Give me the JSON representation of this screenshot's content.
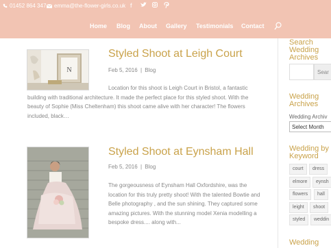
{
  "topbar": {
    "phone": "01452 864 347",
    "email": "emma@the-flower-girls.co.uk",
    "social_icons": [
      "facebook-icon",
      "twitter-icon",
      "instagram-icon",
      "pinterest-icon"
    ]
  },
  "nav": {
    "items": [
      "Home",
      "Blog",
      "About",
      "Gallery",
      "Testimonials",
      "Contact"
    ]
  },
  "posts": [
    {
      "title": "Styled Shoot at Leigh Court",
      "date": "Feb 5, 2016",
      "separator": "|",
      "category": "Blog",
      "excerpt": "Location for this shoot is Leigh Court in Bristol, a fantastic building with traditional architecture. It made the perfect place for this styled shoot. With the beauty of Sophie (Miss Cheltenham) this shoot came alive with her character! The flowers included, black…"
    },
    {
      "title": "Styled Shoot at Eynsham Hall",
      "date": "Feb 5, 2016",
      "separator": "|",
      "category": "Blog",
      "excerpt": "The gorgeousness of Eynsham Hall Oxfordshire, was the location for this truly pretty shoot! With the talented Bowtie and Belle photography , and the sun shining. They captured some amazing pictures. With the stunning model Xenia modelling a bespoke dress.... along with..."
    }
  ],
  "sidebar": {
    "search_title": "Search Wedding Archives",
    "search_button": "Sear",
    "archives_title": "Wedding Archives",
    "archives_label": "Wedding Archiv",
    "archives_select": "Select Month",
    "keyword_title": "Wedding by Keyword",
    "tags": [
      "court",
      "dress",
      "elmore",
      "eynsh",
      "flowers",
      "hall",
      "leight",
      "shoot",
      "styled",
      "weddin"
    ],
    "next_title": "Wedding"
  },
  "colors": {
    "header_bg": "#f2c4b3",
    "accent": "#c9a24a",
    "body_text": "#888888"
  }
}
